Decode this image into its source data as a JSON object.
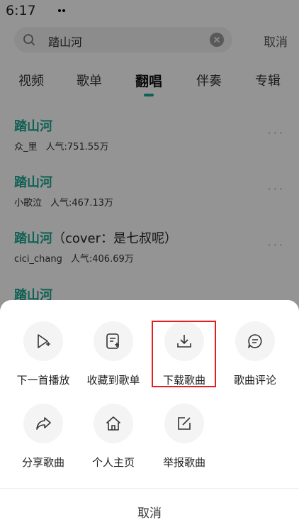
{
  "status_bar": {
    "time": "6:17"
  },
  "search": {
    "query": "踏山河",
    "cancel_label": "取消"
  },
  "tabs": [
    {
      "label": "视频"
    },
    {
      "label": "歌单"
    },
    {
      "label": "翻唱",
      "active": true
    },
    {
      "label": "伴奏"
    },
    {
      "label": "专辑"
    }
  ],
  "results": [
    {
      "title": "踏山河",
      "title_suffix": "",
      "artist": "众_里",
      "popularity": "人气:751.55万"
    },
    {
      "title": "踏山河",
      "title_suffix": "",
      "artist": "小歌泣",
      "popularity": "人气:467.13万"
    },
    {
      "title": "踏山河",
      "title_suffix": "（cover：是七叔呢）",
      "artist": "cici_chang",
      "popularity": "人气:406.69万"
    },
    {
      "title": "踏山河",
      "title_suffix": "",
      "artist": "",
      "popularity": ""
    }
  ],
  "sheet": {
    "actions": [
      {
        "label": "下一首播放",
        "icon": "play-next-icon"
      },
      {
        "label": "收藏到歌单",
        "icon": "add-to-playlist-icon"
      },
      {
        "label": "下载歌曲",
        "icon": "download-icon",
        "highlighted": true
      },
      {
        "label": "歌曲评论",
        "icon": "comment-icon"
      },
      {
        "label": "分享歌曲",
        "icon": "share-icon"
      },
      {
        "label": "个人主页",
        "icon": "home-icon"
      },
      {
        "label": "举报歌曲",
        "icon": "report-icon"
      }
    ],
    "cancel_label": "取消"
  },
  "colors": {
    "accent": "#1aa891",
    "highlight_border": "#e02020",
    "overlay": "rgba(0,0,0,0.42)"
  }
}
